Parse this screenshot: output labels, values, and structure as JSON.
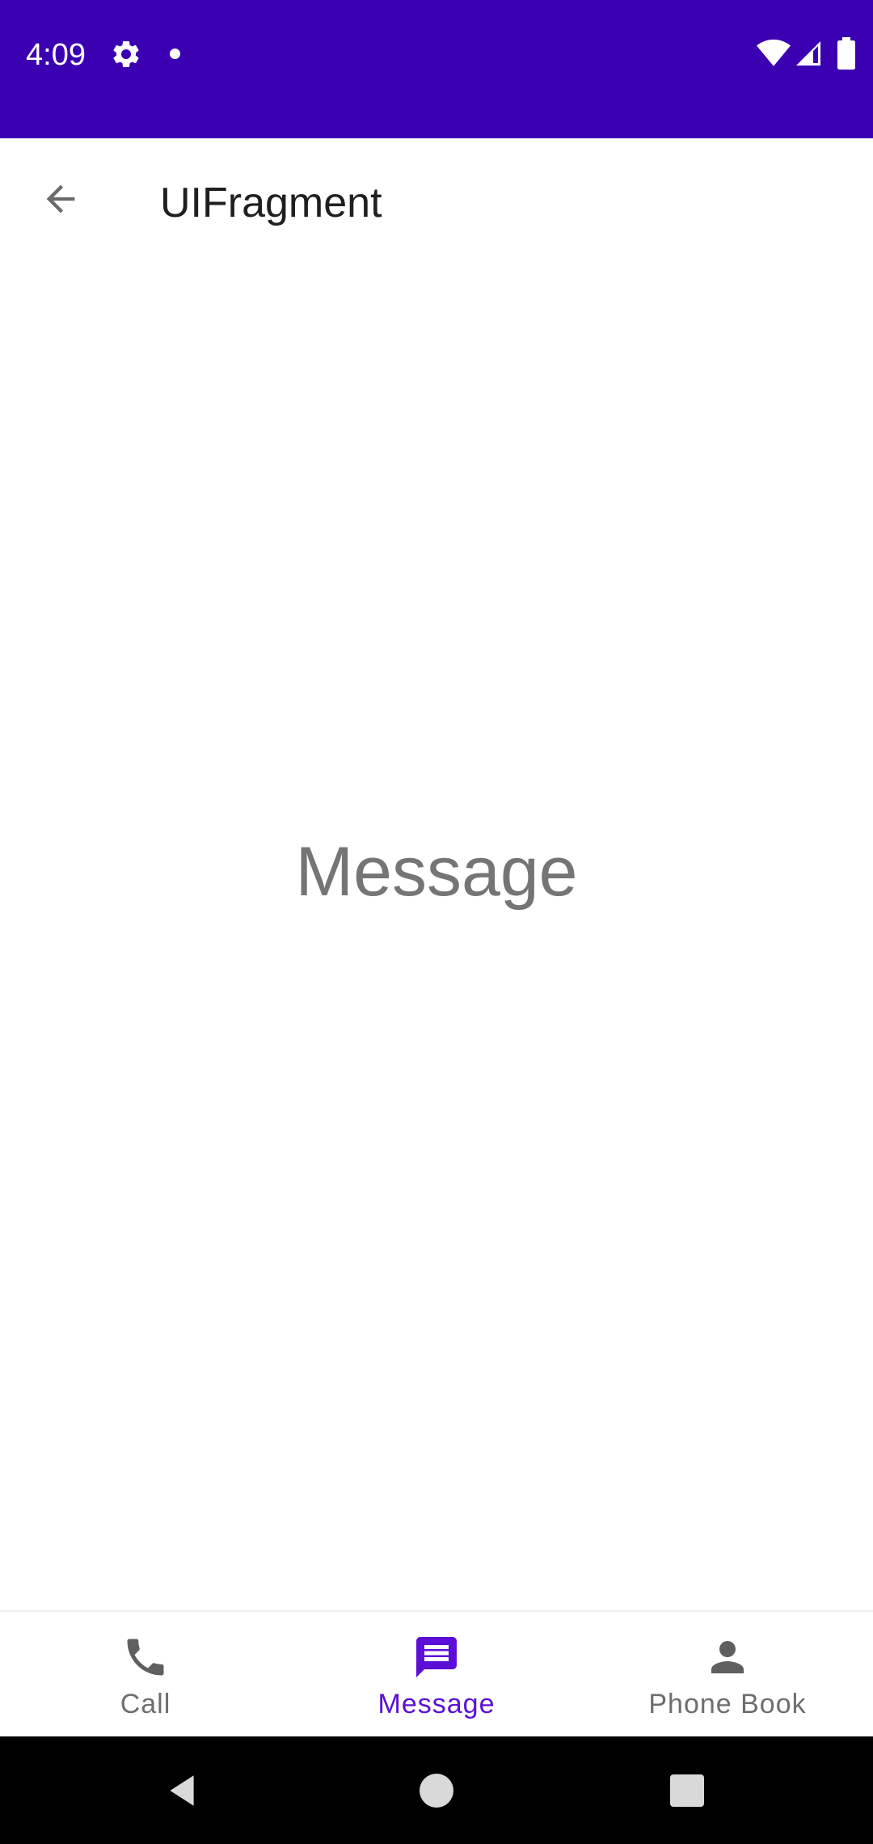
{
  "status_bar": {
    "time": "4:09",
    "background_color": "#3c00b3",
    "icons": [
      "gear-icon",
      "dot-icon",
      "wifi-icon",
      "signal-icon",
      "battery-icon"
    ]
  },
  "app_bar": {
    "title": "UIFragment",
    "back_icon": "arrow-back-icon"
  },
  "content": {
    "text": "Message"
  },
  "bottom_nav": {
    "active_color": "#5b0fd6",
    "inactive_color": "#6e6e6e",
    "items": [
      {
        "label": "Call",
        "icon": "phone-icon",
        "active": false
      },
      {
        "label": "Message",
        "icon": "message-icon",
        "active": true
      },
      {
        "label": "Phone Book",
        "icon": "person-icon",
        "active": false
      }
    ]
  },
  "system_nav": {
    "buttons": [
      "back-triangle-icon",
      "home-circle-icon",
      "recents-square-icon"
    ]
  }
}
